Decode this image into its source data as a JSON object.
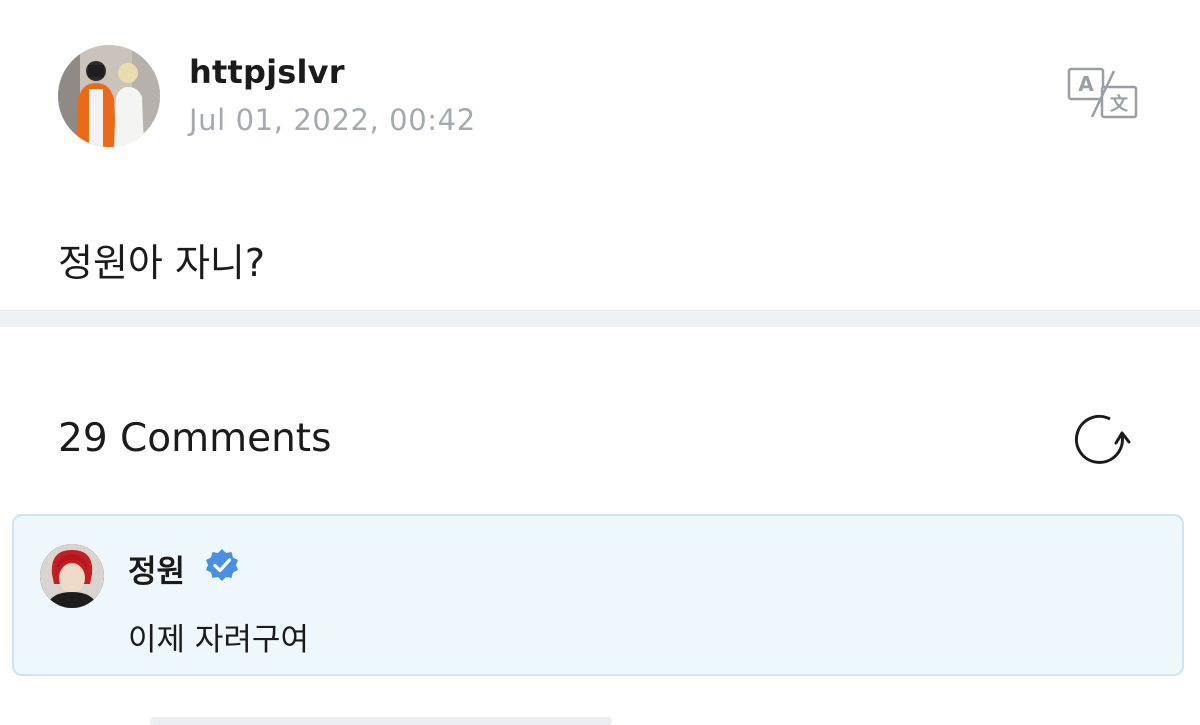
{
  "post": {
    "author": "httpjslvr",
    "timestamp": "Jul 01, 2022, 00:42",
    "body": "정원아 자니?",
    "avatar": "user-photo",
    "translate_icon": "translate-icon"
  },
  "comments": {
    "header": "29 Comments",
    "refresh_icon": "refresh-icon",
    "highlighted": {
      "author": "정원",
      "verified": true,
      "text": "이제 자려구여",
      "avatar": "artist-photo"
    }
  },
  "colors": {
    "timestamp": "#a5a9b0",
    "highlight_background": "#eef8fc",
    "highlight_border": "#cfe4ec",
    "verified_badge": "#4a90e2",
    "divider": "#f0f1f4"
  }
}
